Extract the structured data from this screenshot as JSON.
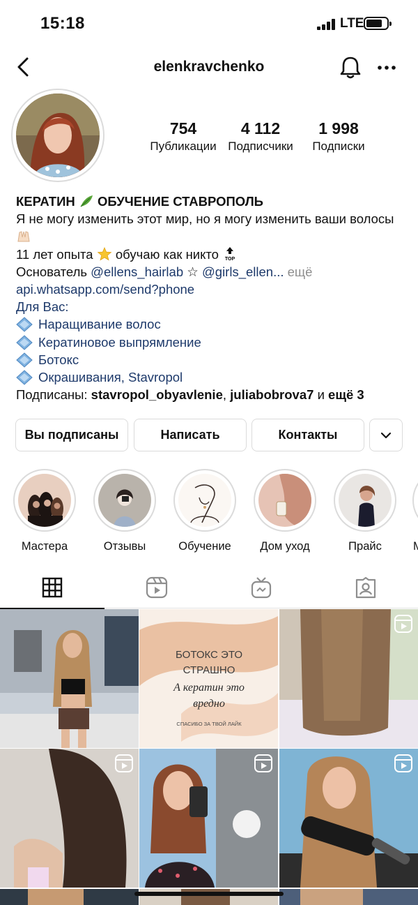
{
  "status_bar": {
    "time": "15:18",
    "network": "LTE"
  },
  "header": {
    "username": "elenkravchenko",
    "icons": [
      "back-arrow-icon",
      "bell-icon",
      "more-icon"
    ]
  },
  "stats": [
    {
      "value": "754",
      "label": "Публикации"
    },
    {
      "value": "4 112",
      "label": "Подписчики"
    },
    {
      "value": "1 998",
      "label": "Подписки"
    }
  ],
  "bio": {
    "name_part1": "КЕРАТИН",
    "name_part2": "ОБУЧЕНИЕ СТАВРОПОЛЬ",
    "line1": "Я не могу изменить этот мир, но я могу изменить ваши волосы",
    "line2a": "11 лет опыта",
    "line2b": "обучаю как никто",
    "founder_prefix": "Основатель",
    "mention1": "@ellens_hairlab",
    "star": "☆",
    "mention2": "@girls_ellen...",
    "more": "ещё",
    "website": "api.whatsapp.com/send?phone",
    "for_you": "Для Вас:",
    "services": [
      "Наращивание волос",
      "Кератиновое выпрямление",
      "Ботокс",
      "Окрашивания, Stavropol"
    ],
    "followed_prefix": "Подписаны:",
    "followed_user1": "stavropol_obyavlenie",
    "followed_sep": ",",
    "followed_user2": "juliabobrova7",
    "followed_and": "и",
    "followed_more": "ещё 3"
  },
  "actions": {
    "following": "Вы подписаны",
    "message": "Написать",
    "contacts": "Контакты"
  },
  "highlights": [
    "Мастера",
    "Отзывы",
    "Обучение",
    "Дом уход",
    "Прайс",
    "М"
  ],
  "tabs": [
    "grid-icon",
    "reels-icon",
    "igtv-icon",
    "tagged-icon"
  ],
  "posts": [
    {
      "text_lines": []
    },
    {
      "text_lines": [
        "БОТОКС ЭТО",
        "СТРАШНО",
        "А кератин это",
        "вредно",
        "СПАСИБО ЗА ТВОЙ ЛАЙК"
      ]
    },
    {
      "text_lines": []
    }
  ]
}
